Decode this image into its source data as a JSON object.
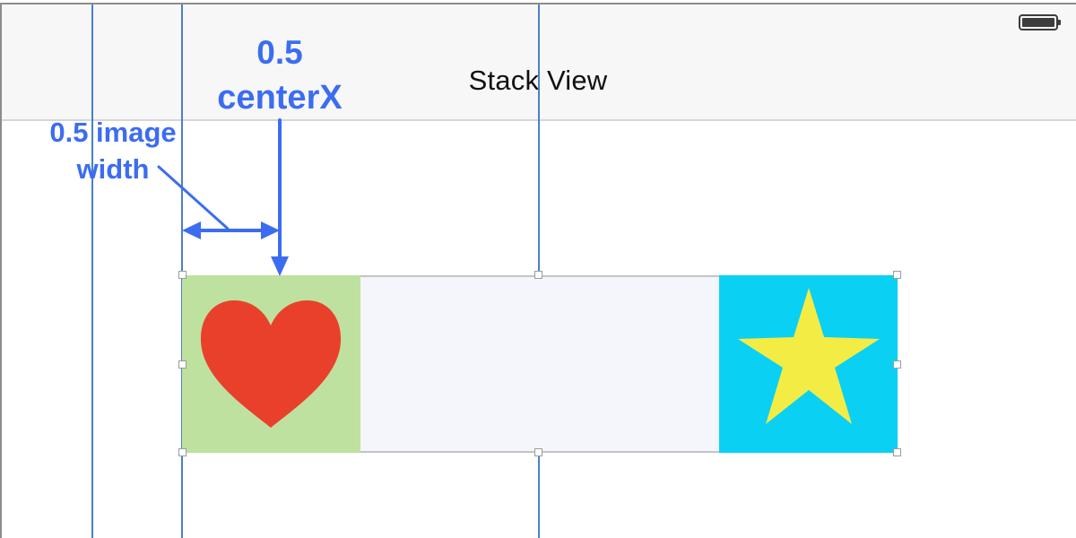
{
  "nav_bar": {
    "title": "Stack View",
    "background": "#f7f7f7"
  },
  "status_bar": {
    "battery_icon": "battery-full-icon"
  },
  "stack_view": {
    "arranged_views": [
      {
        "name": "heart image",
        "icon": "heart-icon",
        "background": "#bfe19f",
        "icon_color": "#e9402c"
      },
      {
        "name": "empty spacer",
        "background": "#f5f6fb"
      },
      {
        "name": "star image",
        "icon": "star-icon",
        "background": "#0ad0f4",
        "icon_color": "#f3ec45"
      }
    ]
  },
  "annotations": {
    "centerx": {
      "value": "0.5",
      "label": "centerX"
    },
    "image_width": {
      "line1": "0.5 image",
      "line2": "width"
    },
    "color": "#3c6df0"
  },
  "guides": {
    "color": "#4a80c8"
  }
}
